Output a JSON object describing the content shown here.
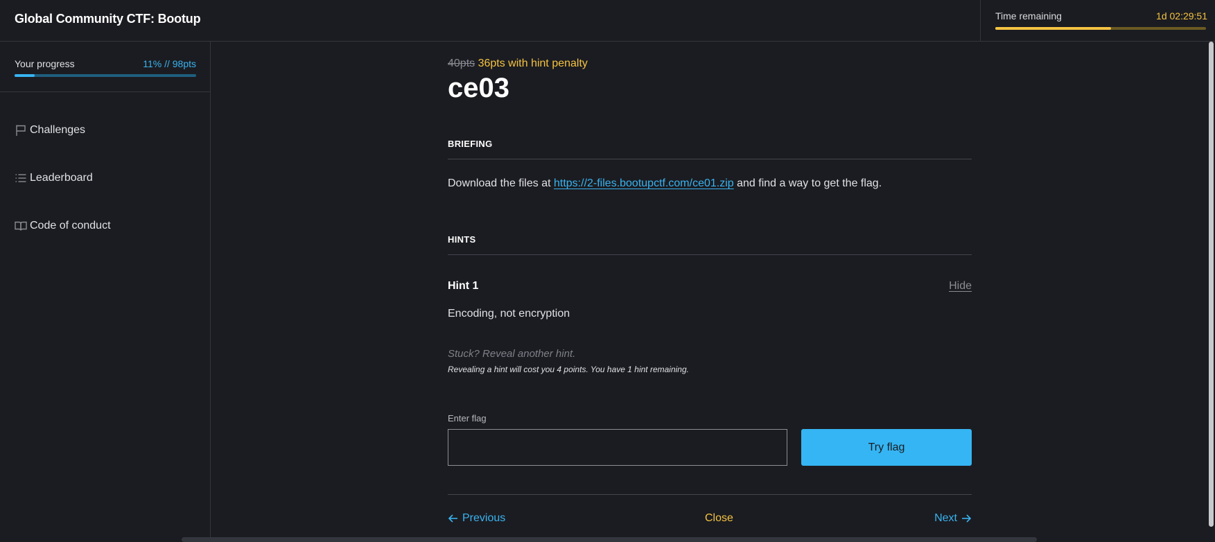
{
  "header": {
    "title": "Global Community CTF: Bootup",
    "timer": {
      "label": "Time remaining",
      "value": "1d 02:29:51",
      "fraction_remaining": 0.55
    }
  },
  "sidebar": {
    "progress": {
      "label": "Your progress",
      "value": "11% // 98pts",
      "fraction": 0.11
    },
    "items": [
      {
        "label": "Challenges",
        "icon": "flag-icon"
      },
      {
        "label": "Leaderboard",
        "icon": "list-icon"
      },
      {
        "label": "Code of conduct",
        "icon": "book-icon"
      }
    ]
  },
  "challenge": {
    "points_original": "40pts",
    "points_penalty": "36pts with hint penalty",
    "title": "ce03",
    "briefing_heading": "BRIEFING",
    "briefing_before": "Download the files at ",
    "briefing_link": "https://2-files.bootupctf.com/ce01.zip",
    "briefing_after": " and find a way to get the flag.",
    "hints_heading": "HINTS",
    "hint": {
      "title": "Hint 1",
      "hide_label": "Hide",
      "text": "Encoding, not encryption"
    },
    "reveal_label": "Stuck? Reveal another hint.",
    "reveal_note": "Revealing a hint will cost you 4 points. You have 1 hint remaining.",
    "flag": {
      "label": "Enter flag",
      "value": "",
      "placeholder": "",
      "button_label": "Try flag"
    },
    "nav": {
      "previous": "Previous",
      "close": "Close",
      "next": "Next"
    }
  },
  "colors": {
    "accent_blue": "#39b3f0",
    "accent_yellow": "#f5c342",
    "background": "#1b1c21"
  }
}
